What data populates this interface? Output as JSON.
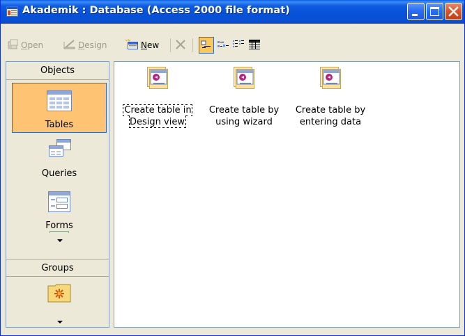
{
  "window": {
    "title": "Akademik : Database (Access 2000 file format)"
  },
  "toolbar": {
    "open_label": "Open",
    "design_label": "Design",
    "new_label": "New"
  },
  "objects_bar": {
    "objects_header": "Objects",
    "groups_header": "Groups",
    "items": [
      {
        "label": "Tables",
        "icon": "table-icon",
        "selected": true
      },
      {
        "label": "Queries",
        "icon": "query-icon",
        "selected": false
      },
      {
        "label": "Forms",
        "icon": "form-icon",
        "selected": false
      }
    ]
  },
  "list": {
    "items": [
      {
        "label": "Create table in\nDesign view",
        "icon": "create-table-icon"
      },
      {
        "label": "Create table by\nusing wizard",
        "icon": "create-table-icon"
      },
      {
        "label": "Create table by\nentering data",
        "icon": "create-table-icon"
      }
    ]
  },
  "colors": {
    "titlebar": "#0651d8",
    "selection": "#ffc473",
    "selection_border": "#316ac5",
    "frame": "#ece9d8"
  }
}
